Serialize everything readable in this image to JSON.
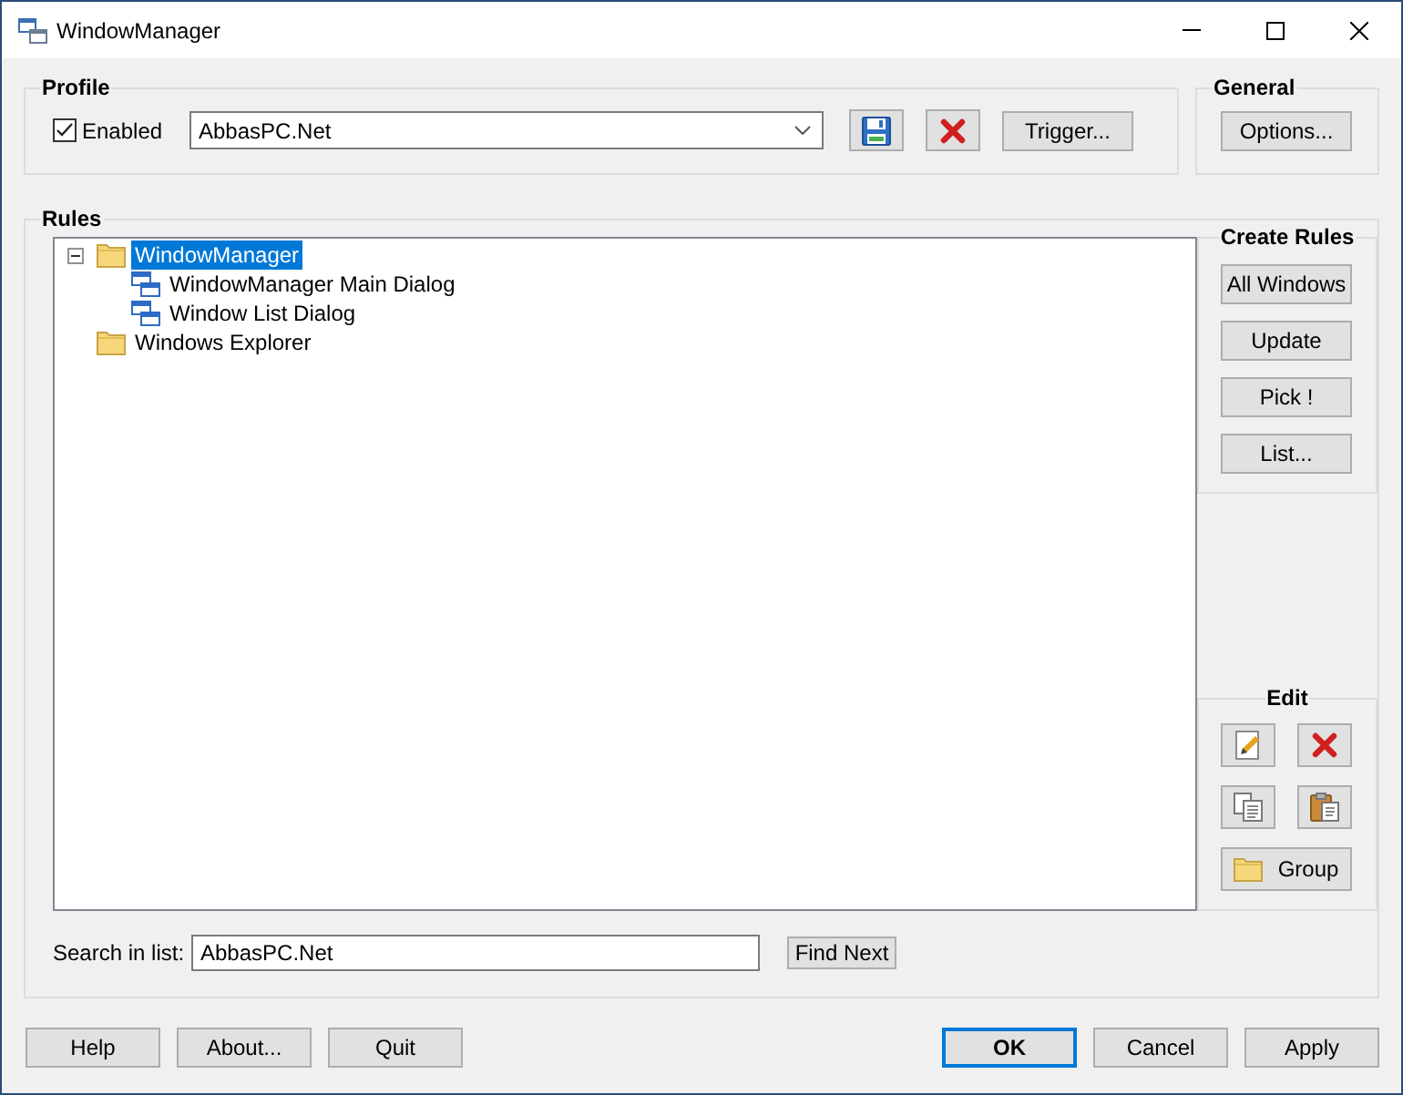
{
  "window": {
    "title": "WindowManager"
  },
  "profile": {
    "title": "Profile",
    "enabled": {
      "label": "Enabled",
      "checked": true
    },
    "profile_select": {
      "value": "AbbasPC.Net"
    },
    "trigger_button": "Trigger..."
  },
  "general": {
    "title": "General",
    "options_button": "Options..."
  },
  "rules": {
    "title": "Rules",
    "tree": [
      {
        "label": "WindowManager",
        "kind": "folder",
        "selected": true,
        "expanded": true,
        "children": [
          {
            "label": "WindowManager Main Dialog",
            "kind": "window",
            "selected": false
          },
          {
            "label": "Window List Dialog",
            "kind": "window",
            "selected": false
          }
        ]
      },
      {
        "label": "Windows Explorer",
        "kind": "folder",
        "selected": false
      }
    ],
    "create_rules": {
      "title": "Create Rules",
      "buttons": [
        "All Windows",
        "Update",
        "Pick !",
        "List..."
      ]
    },
    "edit": {
      "title": "Edit",
      "group_button": "Group"
    },
    "search": {
      "label": "Search in list:",
      "value": "AbbasPC.Net",
      "find_button": "Find Next"
    }
  },
  "dialog_buttons": {
    "left": [
      {
        "label": "Help",
        "default": false
      },
      {
        "label": "About...",
        "default": false
      },
      {
        "label": "Quit",
        "default": false
      }
    ],
    "right": [
      {
        "label": "OK",
        "default": true
      },
      {
        "label": "Cancel",
        "default": false
      },
      {
        "label": "Apply",
        "default": false
      }
    ]
  }
}
